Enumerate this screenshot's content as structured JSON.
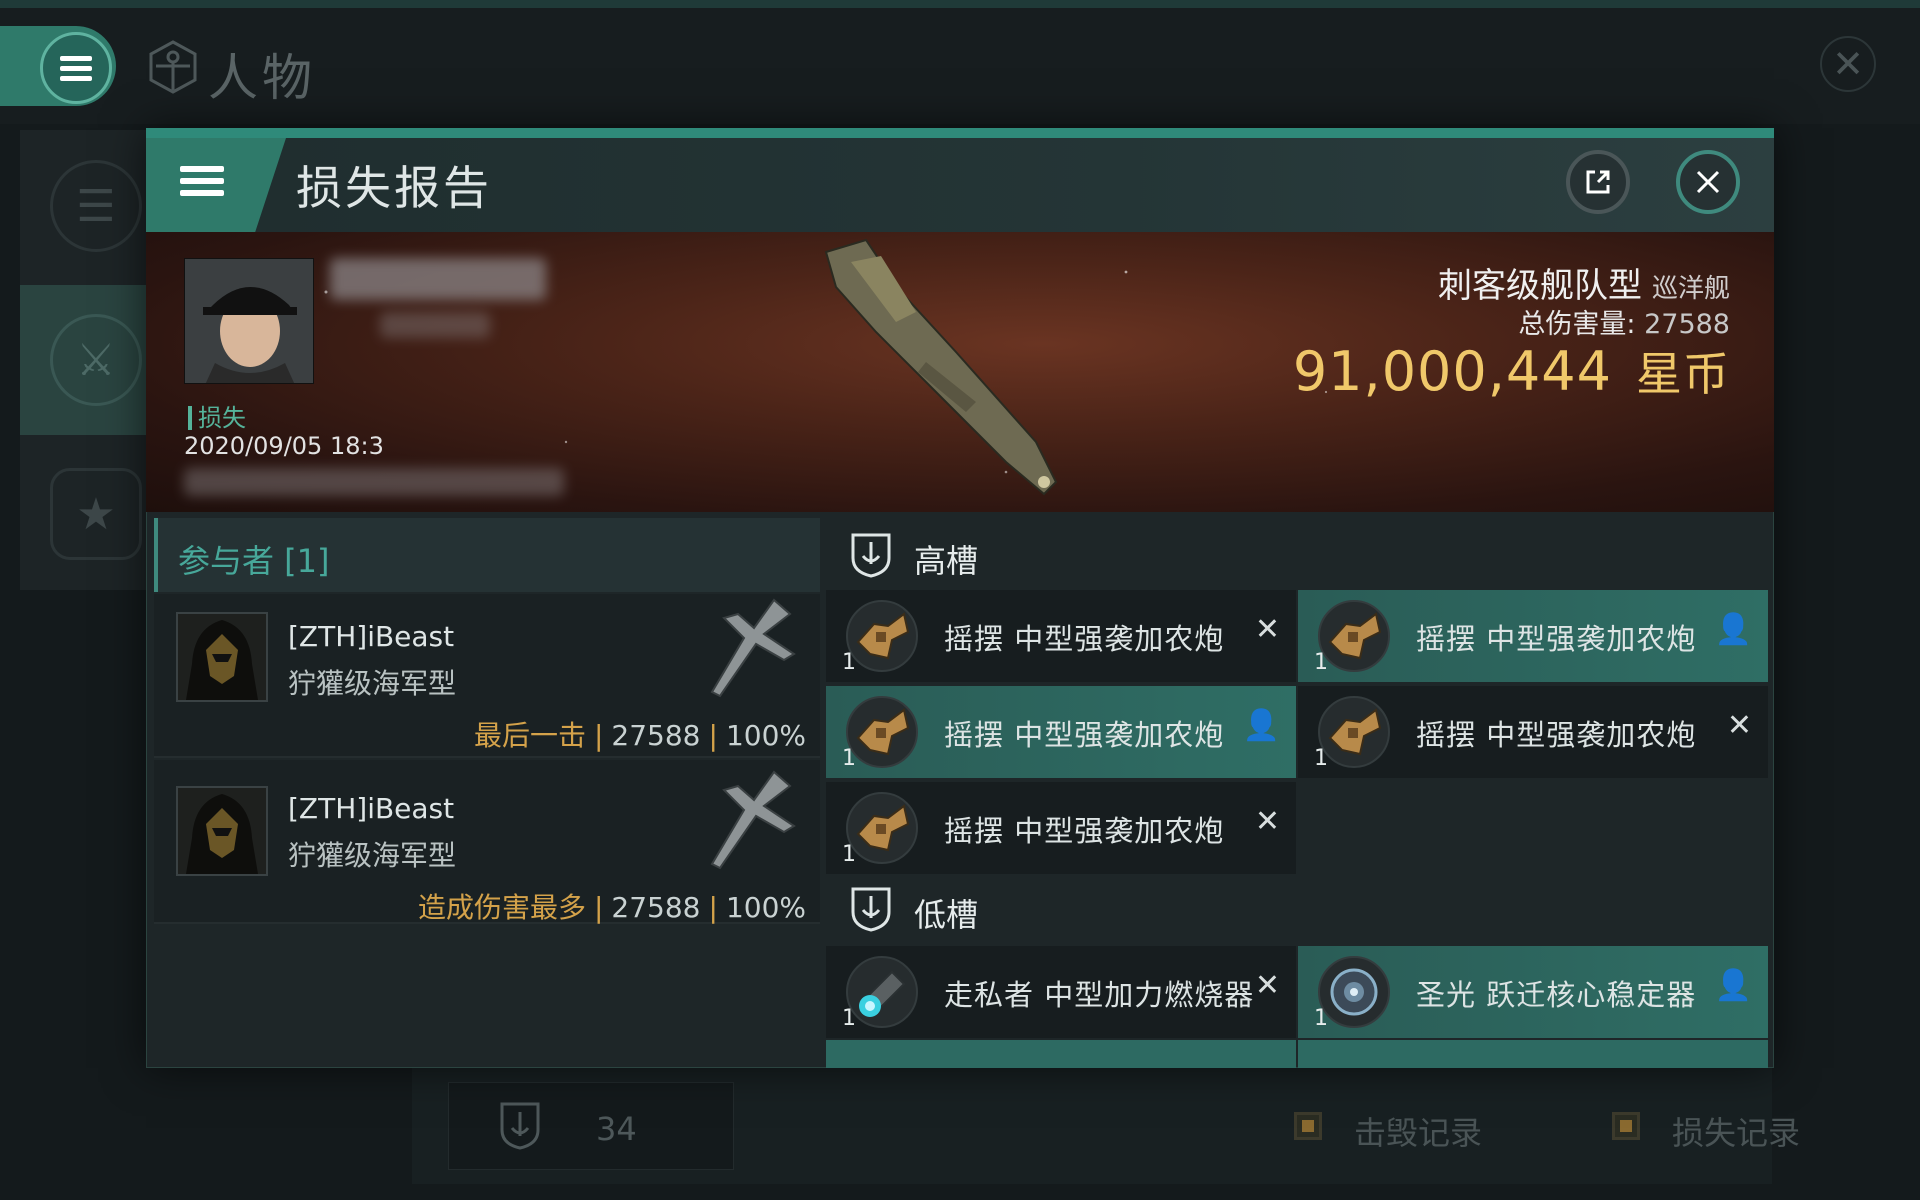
{
  "app": {
    "title": "人物"
  },
  "modal": {
    "title": "损失报告"
  },
  "victim": {
    "status": "损失",
    "time": "2020/09/05 18:3",
    "ship_name": "刺客级舰队型",
    "ship_class": "巡洋舰",
    "damage_label": "总伤害量",
    "damage_value": "27588",
    "isk_value": "91,000,444",
    "isk_unit": "星币"
  },
  "attackers": {
    "header": "参与者 [1]",
    "rows": [
      {
        "name": "[ZTH]iBeast",
        "ship": "狞獾级海军型",
        "tag": "最后一击",
        "damage": "27588",
        "percent": "100%"
      },
      {
        "name": "[ZTH]iBeast",
        "ship": "狞獾级海军型",
        "tag": "造成伤害最多",
        "damage": "27588",
        "percent": "100%"
      }
    ]
  },
  "fitting": {
    "high_label": "高槽",
    "low_label": "低槽",
    "high": [
      {
        "name": "摇摆 中型强袭加农炮",
        "qty": "1",
        "state": "destroyed",
        "end": "✕"
      },
      {
        "name": "摇摆 中型强袭加农炮",
        "qty": "1",
        "state": "dropped",
        "end": "👤"
      },
      {
        "name": "摇摆 中型强袭加农炮",
        "qty": "1",
        "state": "dropped",
        "end": "👤"
      },
      {
        "name": "摇摆 中型强袭加农炮",
        "qty": "1",
        "state": "destroyed",
        "end": "✕"
      },
      {
        "name": "摇摆 中型强袭加农炮",
        "qty": "1",
        "state": "destroyed",
        "end": "✕"
      }
    ],
    "low": [
      {
        "name": "走私者 中型加力燃烧器",
        "qty": "1",
        "state": "destroyed",
        "end": "✕"
      },
      {
        "name": "圣光 跃迁核心稳定器",
        "qty": "1",
        "state": "dropped",
        "end": "👤"
      }
    ]
  },
  "background": {
    "count": "34",
    "kills_label": "击毁记录",
    "losses_label": "损失记录"
  },
  "colors": {
    "accent": "#2f7a6a",
    "gold": "#f0c86a",
    "highlight": "#2f6e65"
  }
}
